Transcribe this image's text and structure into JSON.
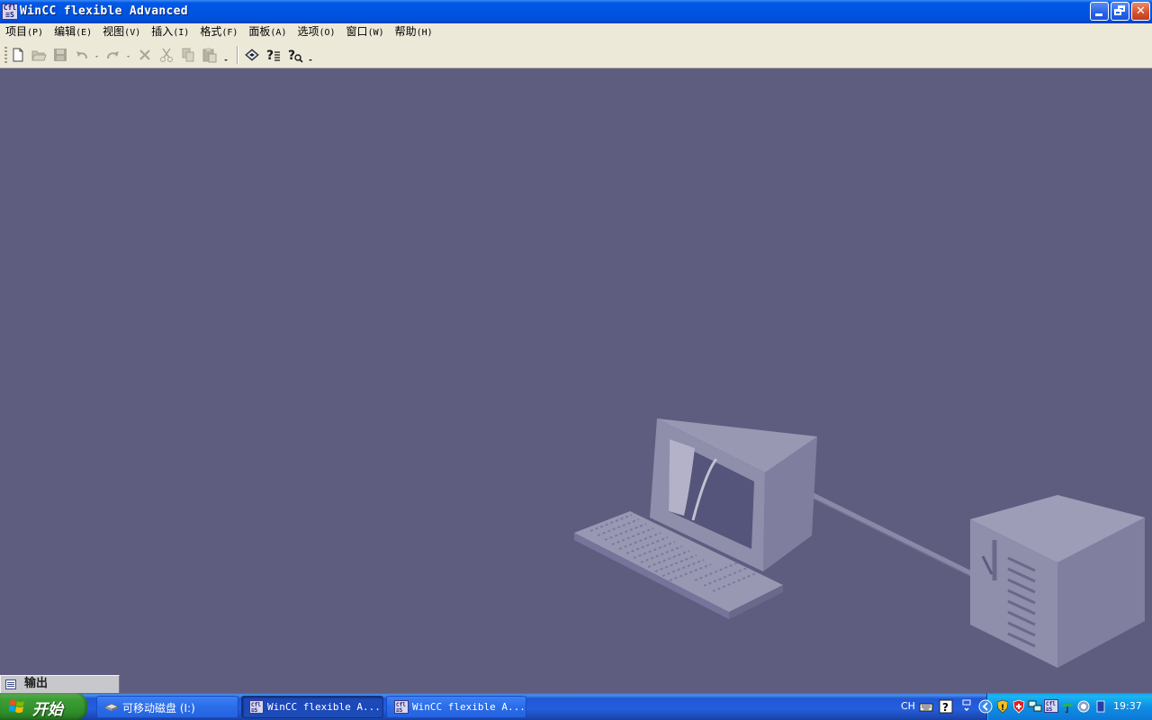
{
  "window": {
    "title": "WinCC flexible Advanced"
  },
  "menu": {
    "items": [
      {
        "label": "项目",
        "accel": "(P)"
      },
      {
        "label": "编辑",
        "accel": "(E)"
      },
      {
        "label": "视图",
        "accel": "(V)"
      },
      {
        "label": "插入",
        "accel": "(I)"
      },
      {
        "label": "格式",
        "accel": "(F)"
      },
      {
        "label": "面板",
        "accel": "(A)"
      },
      {
        "label": "选项",
        "accel": "(O)"
      },
      {
        "label": "窗口",
        "accel": "(W)"
      },
      {
        "label": "帮助",
        "accel": "(H)"
      }
    ]
  },
  "toolbar": {
    "buttons": [
      "new-file-icon",
      "open-folder-icon",
      "save-icon",
      "undo-icon",
      "redo-icon",
      "delete-icon",
      "cut-icon",
      "copy-icon",
      "paste-icon",
      "transfer-icon",
      "help-topics-icon",
      "whats-this-help-icon"
    ]
  },
  "output": {
    "label": "输出"
  },
  "taskbar": {
    "start_label": "开始",
    "tasks": [
      {
        "label": "可移动磁盘 (I:)"
      },
      {
        "label": "WinCC flexible A..."
      },
      {
        "label": "WinCC flexible A..."
      }
    ],
    "language": "CH",
    "clock": "19:37"
  },
  "colors": {
    "workspace_bg": "#5e5d80",
    "titlebar_blue": "#0054e3",
    "taskbar_blue": "#245edc",
    "start_green": "#3c9d36"
  }
}
